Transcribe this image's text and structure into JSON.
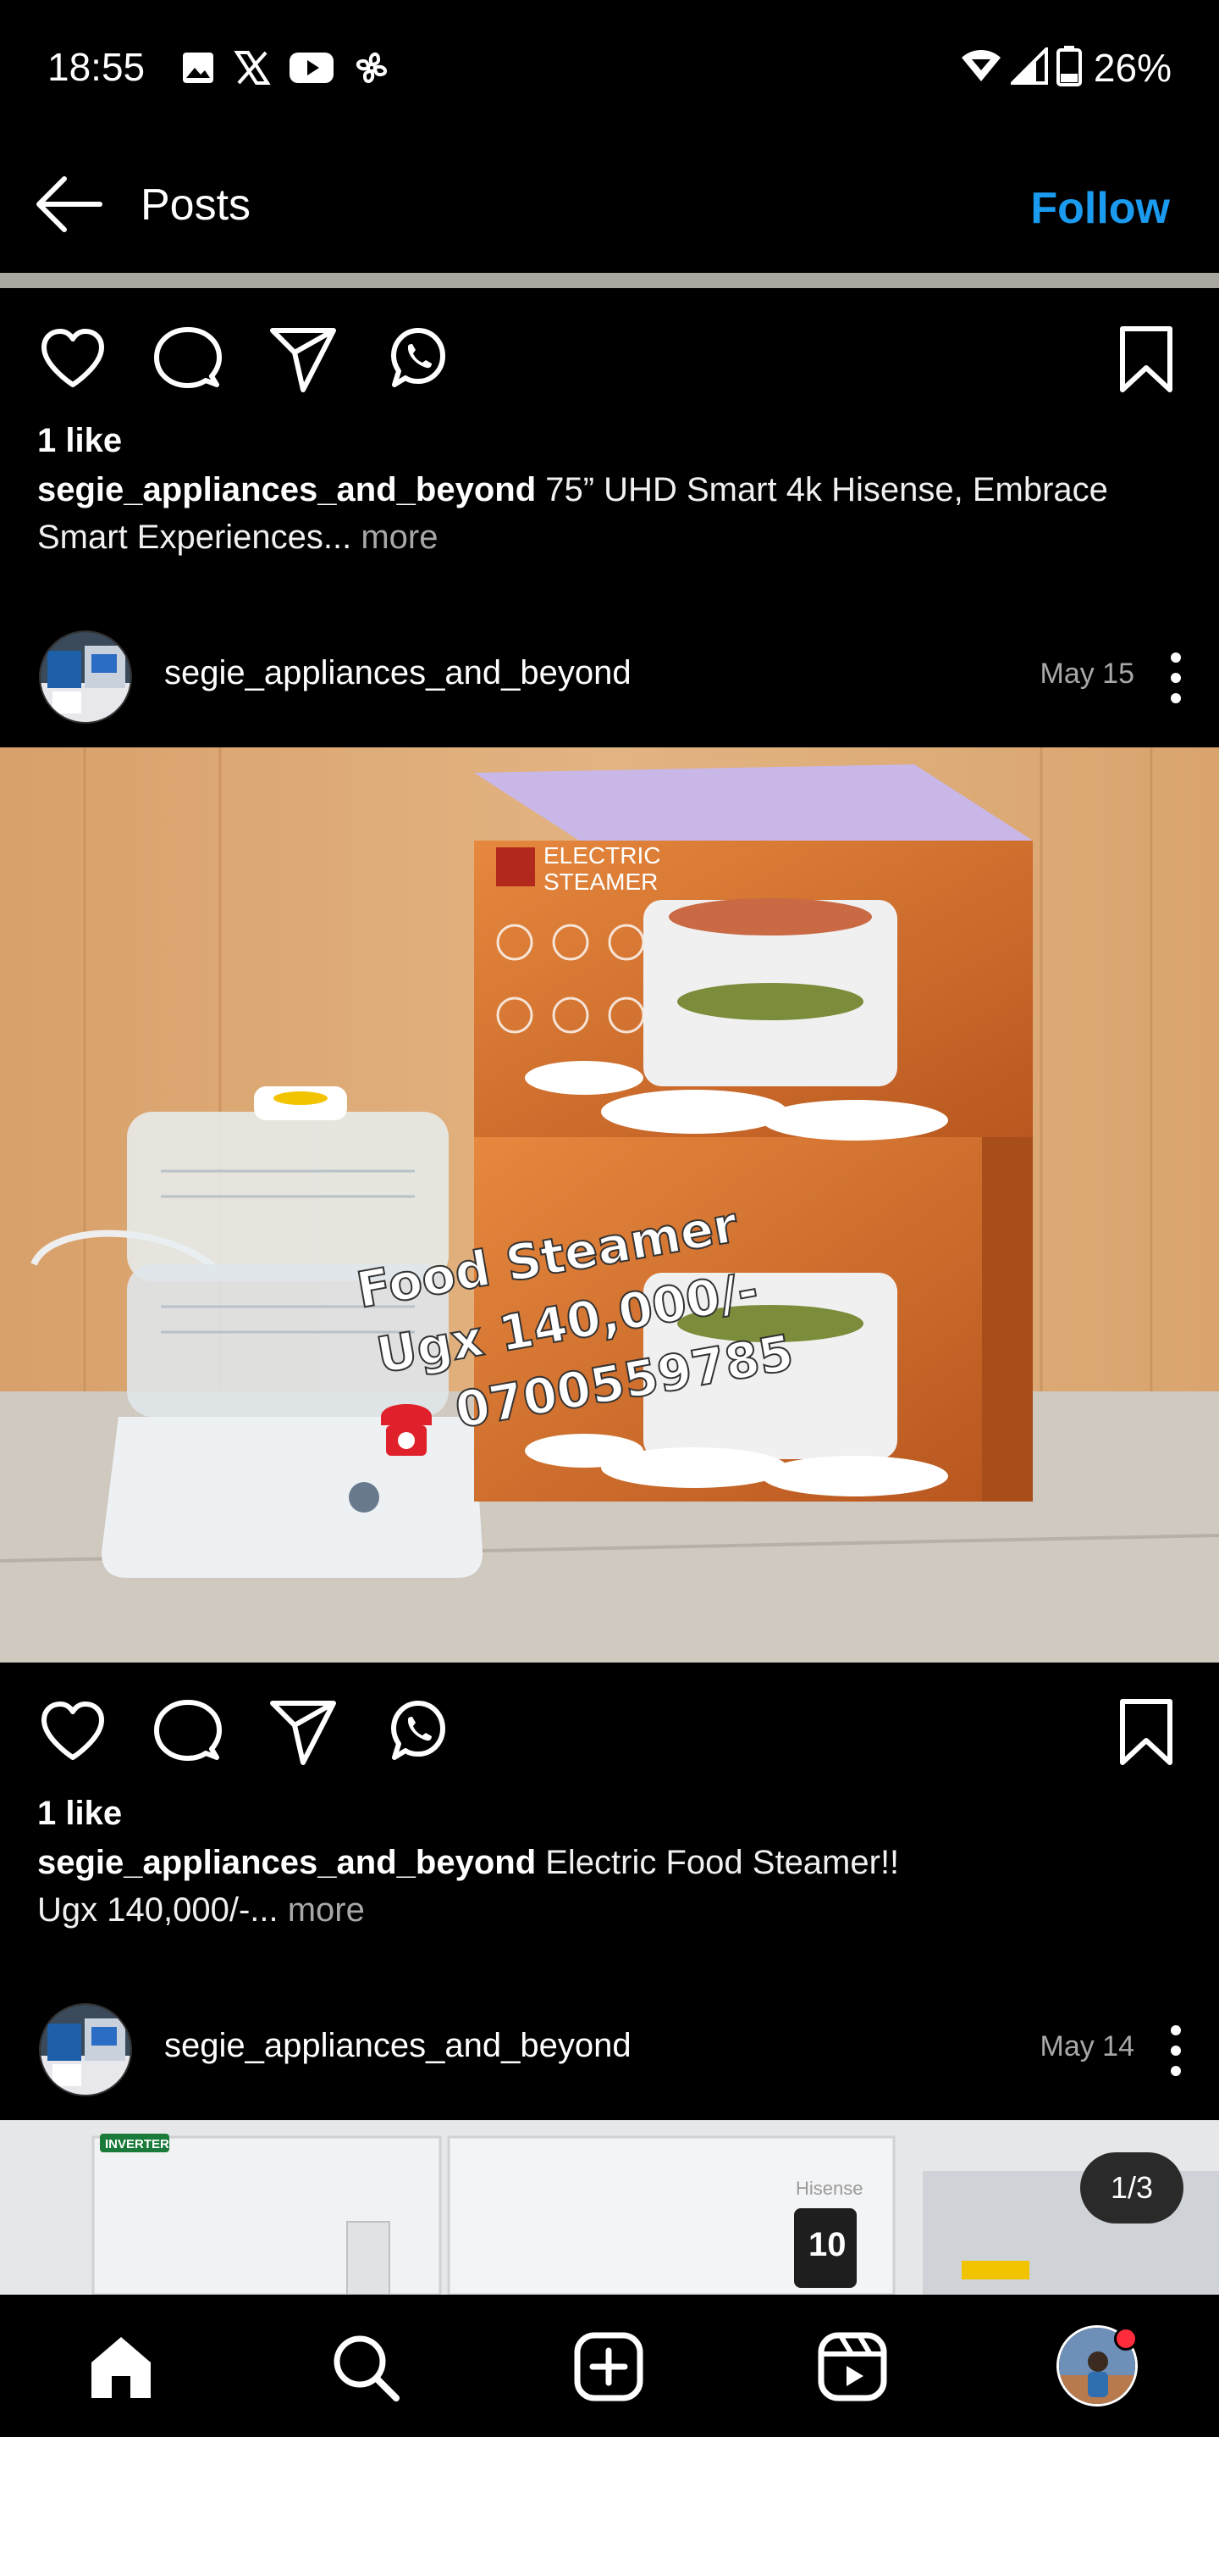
{
  "status_bar": {
    "time": "18:55",
    "battery": "26%",
    "icons": [
      "gallery-icon",
      "x-icon",
      "youtube-icon",
      "fan-icon",
      "wifi-icon",
      "signal-icon",
      "battery-icon"
    ]
  },
  "header": {
    "title": "Posts",
    "follow_label": "Follow"
  },
  "colors": {
    "background": "#000000",
    "accent": "#1b9bef",
    "secondary_text": "#a8a8a8",
    "notification": "#ff2d3c"
  },
  "posts": [
    {
      "likes": "1 like",
      "caption_user": "segie_appliances_and_beyond",
      "caption_text": " 75” UHD Smart 4k Hisense, Embrace Smart Experiences...",
      "caption_more": " more"
    },
    {
      "user": "segie_appliances_and_beyond",
      "date": "May 15",
      "image_text": {
        "line1": "Food Steamer",
        "line2": "Ugx 140,000/-",
        "line3": "0700559785",
        "box_label_1": "ELECTRIC",
        "box_label_2": "STEAMER"
      },
      "likes": "1 like",
      "caption_user": "segie_appliances_and_beyond",
      "caption_text": " Electric Food Steamer!! Ugx 140,000/-...",
      "caption_more": " more"
    },
    {
      "user": "segie_appliances_and_beyond",
      "date": "May 14",
      "carousel_position": "1/3",
      "image_text": {
        "brand": "Hisense",
        "warranty_number": "10",
        "tag": "INVERTER"
      }
    }
  ],
  "nav": {
    "items": [
      "home-icon",
      "search-icon",
      "create-icon",
      "reels-icon",
      "profile-avatar"
    ]
  }
}
